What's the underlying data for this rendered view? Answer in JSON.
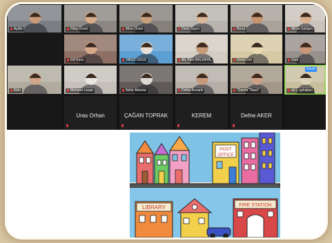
{
  "tiles": [
    {
      "name": "Aydin",
      "color": "#7b7f84",
      "face": "#c99b7a"
    },
    {
      "name": "Nilay Önsel",
      "color": "#8c8782",
      "face": "#d6ac8b"
    },
    {
      "name": "Mine Önsel",
      "color": "#85817a",
      "face": "#c9a07e"
    },
    {
      "name": "Derin Sayın",
      "color": "#b8b4ad",
      "face": "#d9b698"
    },
    {
      "name": "Berra",
      "color": "#a8a29a",
      "face": "#c7946f"
    },
    {
      "name": "Mirza Gürişen",
      "color": "#c9c3bb",
      "face": "#d9b08f"
    },
    {
      "name": "Elif Kuzu",
      "color": "#8d6f63",
      "face": "#d8a98a"
    },
    {
      "name": "YAĞIZ UĞUZ",
      "color": "#5b9fd3",
      "face": "#e6dfd5"
    },
    {
      "name": "Ali, Pars BALKAYA,",
      "color": "#d3ccc2",
      "face": "#c79a78"
    },
    {
      "name": "Deniz Dor",
      "color": "#d7c9a5",
      "face": "#e8d9b0"
    },
    {
      "name": "Zara",
      "color": "#96918b",
      "face": "#c8977a"
    },
    {
      "name": "Ekin",
      "color": "#b1ab9e",
      "face": "#d1a58a"
    },
    {
      "name": "Mehmet Leyan",
      "color": "#c5c0b9",
      "face": "#e9e6e1"
    },
    {
      "name": "Nehir Akbulut",
      "color": "#5f5a57",
      "face": "#dcd8d2"
    },
    {
      "name": "Defne Arıcanlı",
      "color": "#b4aea6",
      "face": "#c79a7c"
    },
    {
      "name": "\"Damla\"\"Nazlı\"",
      "color": "#a29788",
      "face": "#caa086"
    },
    {
      "name": "ali ç. şahaban",
      "color": "#c9bf9f",
      "face": "#ddd3ba",
      "badge": "Kavaı"
    },
    {
      "name": "Kuzey Menteşe",
      "color": "#d8d2cb",
      "face": "#c99a7c"
    }
  ],
  "named_tiles": [
    "Uras Orhan",
    "ÇAĞAN TOPRAK",
    "KEREM",
    "Defne AKER"
  ],
  "drawing": {
    "post_office_sign": "POST OFFICE",
    "library_sign": "LIBRARY",
    "fire_station_sign": "FIRE STATION"
  }
}
